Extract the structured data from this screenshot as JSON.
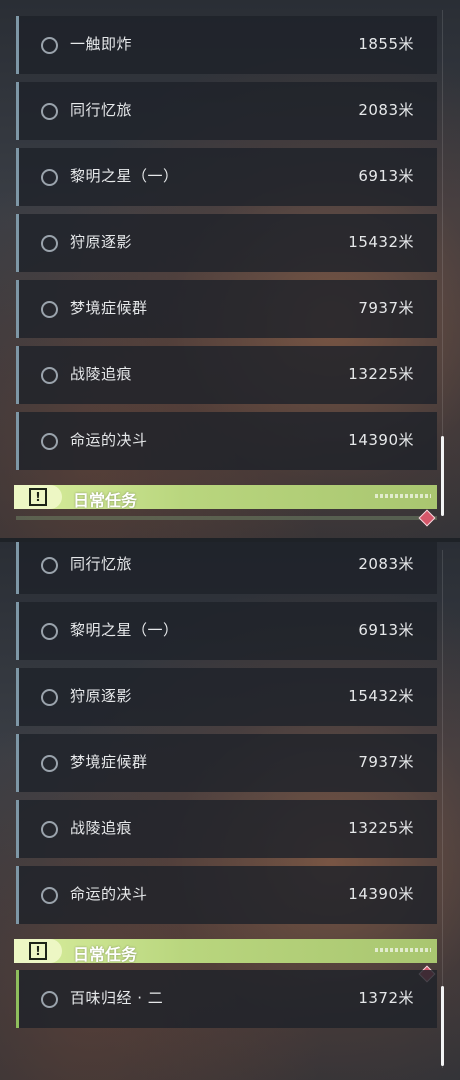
{
  "colors": {
    "card_accent": "#7e97a6",
    "card_accent_daily": "#8fbf5d",
    "section_header": "#c3dd86",
    "marker": "#d4576a"
  },
  "top": {
    "quests": [
      {
        "title": "一触即炸",
        "distance": "1855米"
      },
      {
        "title": "同行忆旅",
        "distance": "2083米"
      },
      {
        "title": "黎明之星（一）",
        "distance": "6913米"
      },
      {
        "title": "狩原逐影",
        "distance": "15432米"
      },
      {
        "title": "梦境症候群",
        "distance": "7937米"
      },
      {
        "title": "战陵追痕",
        "distance": "13225米"
      },
      {
        "title": "命运的决斗",
        "distance": "14390米"
      }
    ],
    "section": {
      "title": "日常任务",
      "icon": "exclamation-icon"
    }
  },
  "bottom": {
    "quests": [
      {
        "title": "同行忆旅",
        "distance": "2083米"
      },
      {
        "title": "黎明之星（一）",
        "distance": "6913米"
      },
      {
        "title": "狩原逐影",
        "distance": "15432米"
      },
      {
        "title": "梦境症候群",
        "distance": "7937米"
      },
      {
        "title": "战陵追痕",
        "distance": "13225米"
      },
      {
        "title": "命运的决斗",
        "distance": "14390米"
      }
    ],
    "section": {
      "title": "日常任务",
      "icon": "exclamation-icon"
    },
    "daily_quests": [
      {
        "title": "百味归经 · 二",
        "distance": "1372米"
      }
    ]
  }
}
